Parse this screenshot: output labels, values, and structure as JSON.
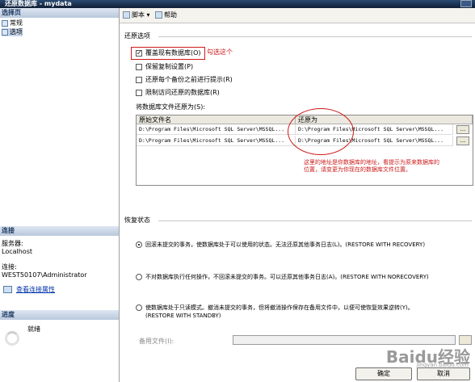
{
  "window": {
    "title": "还原数据库 - mydata"
  },
  "left": {
    "pages_header": "选择页",
    "pages": [
      {
        "label": "常规"
      },
      {
        "label": "选项"
      }
    ],
    "connection_header": "连接",
    "server_label": "服务器:",
    "server_value": "Localhost",
    "conn_label": "连接:",
    "conn_value": "WEST50107\\Administrator",
    "view_link": "查看连接属性",
    "progress_header": "进度",
    "progress_status": "就绪"
  },
  "toolbar": {
    "script_label": "脚本",
    "help_label": "帮助"
  },
  "restore_options": {
    "group_label": "还原选项",
    "checkboxes": [
      {
        "label": "覆盖现有数据库(O)",
        "checked": true
      },
      {
        "label": "保留复制设置(P)",
        "checked": false
      },
      {
        "label": "还原每个备份之前进行提示(R)",
        "checked": false
      },
      {
        "label": "限制访问还原的数据库(R)",
        "checked": false
      }
    ],
    "files_label": "将数据库文件还原为(S):",
    "columns": [
      "原始文件名",
      "还原为"
    ],
    "rows": [
      {
        "original": "D:\\Program Files\\Microsoft SQL Server\\MSSQL...",
        "restore_as": "D:\\Program Files\\Microsoft SQL Server\\MSSQL..."
      },
      {
        "original": "D:\\Program Files\\Microsoft SQL Server\\MSSQL...",
        "restore_as": "D:\\Program Files\\Microsoft SQL Server\\MSSQL..."
      }
    ],
    "browse_label": "..."
  },
  "recovery": {
    "group_label": "恢复状态",
    "options": [
      {
        "text": "回滚未提交的事务，使数据库处于可以使用的状态。无法还原其他事务日志(L)。(RESTORE WITH RECOVERY)",
        "selected": true
      },
      {
        "text": "不对数据库执行任何操作，不回滚未提交的事务。可以还原其他事务日志(A)。(RESTORE WITH NORECOVERY)",
        "selected": false
      },
      {
        "text": "使数据库处于只读模式。撤消未提交的事务，但将撤消操作保存在备用文件中，以便可使恢复效果逆转(Y)。",
        "text2": "(RESTORE WITH STANDBY)",
        "selected": false
      }
    ],
    "standby_label": "备用文件(I):"
  },
  "buttons": {
    "ok": "确定",
    "cancel": "取消"
  },
  "annotations": {
    "check_note": "勾选这个",
    "path_note_line1": "这里的地址是你数据库的地址，看提示为原来数据库的",
    "path_note_line2": "位置，请变更为你现在的数据库文件位置。"
  },
  "watermark": {
    "text": "Baidu经验",
    "url": "jingyan.baidu.com"
  }
}
